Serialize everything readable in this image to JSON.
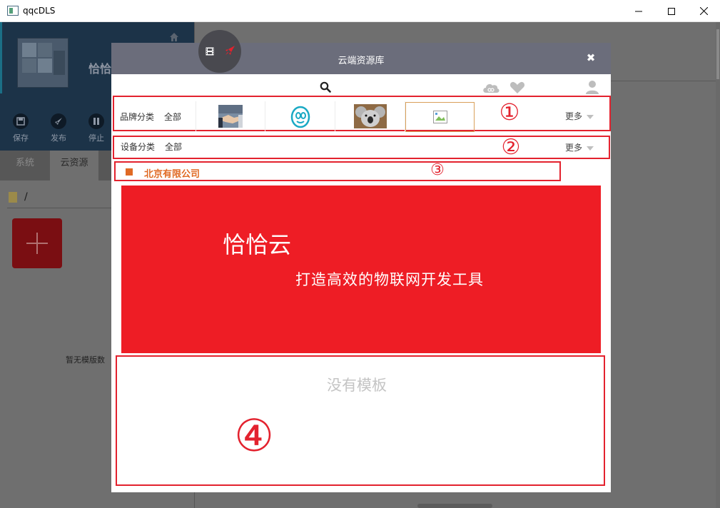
{
  "window": {
    "title": "qqcDLS",
    "controls": [
      "minimize",
      "maximize",
      "close"
    ]
  },
  "background_app": {
    "app_name": "恰恰",
    "toolbar": [
      {
        "label": "保存",
        "icon": "save-icon"
      },
      {
        "label": "发布",
        "icon": "rocket-icon"
      },
      {
        "label": "停止",
        "icon": "pause-icon"
      }
    ],
    "tabs": [
      "系统",
      "云资源"
    ],
    "active_tab": "云资源",
    "path": "/",
    "empty_text": "暂无模版数"
  },
  "dialog": {
    "title": "云端资源库",
    "close_glyph": "✖",
    "brand_filter": {
      "label": "品牌分类",
      "all": "全部",
      "more": "更多",
      "items": [
        "handshake-thumbnail",
        "qq-logo-thumbnail",
        "koala-thumbnail",
        "broken-image-thumbnail"
      ]
    },
    "device_filter": {
      "label": "设备分类",
      "all": "全部",
      "more": "更多"
    },
    "company": "北京有限公司",
    "banner": {
      "title": "恰恰云",
      "subtitle": "打造高效的物联网开发工具",
      "color": "#ee1d25"
    },
    "empty_templates": "没有模板"
  },
  "annotations": {
    "m1": "①",
    "m2": "②",
    "m3": "③",
    "m4": "④",
    "color": "#e3222e"
  }
}
